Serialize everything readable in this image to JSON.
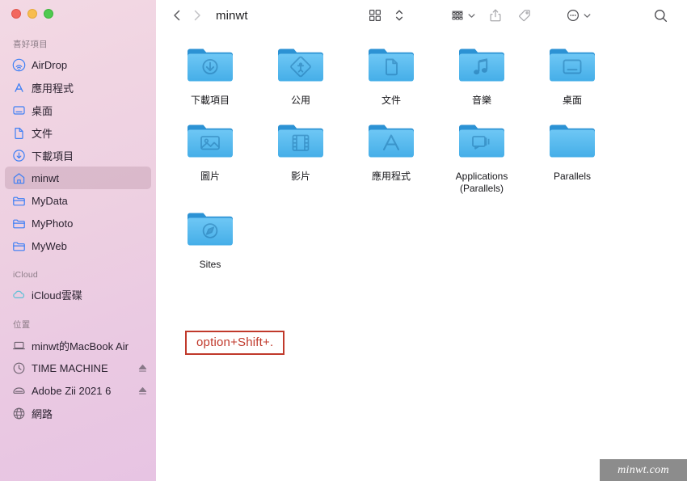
{
  "window": {
    "traffic_lights": [
      {
        "name": "close",
        "color": "#f2685f"
      },
      {
        "name": "minimize",
        "color": "#f8bd4f"
      },
      {
        "name": "maximize",
        "color": "#4fc94f"
      }
    ]
  },
  "toolbar": {
    "back_icon": "chevron-left-icon",
    "forward_icon": "chevron-right-icon",
    "title": "minwt",
    "view_icon": "icon-view-grid-icon",
    "sort_stepper_icon": "up-down-stepper-icon",
    "group_icon": "group-list-icon",
    "group_caret_icon": "chevron-down-icon",
    "share_icon": "share-icon",
    "tag_icon": "tag-icon",
    "more_icon": "more-ellipsis-icon",
    "more_caret_icon": "chevron-down-icon",
    "search_icon": "search-icon"
  },
  "sidebar": {
    "sections": [
      {
        "header": "喜好項目",
        "items": [
          {
            "label": "AirDrop",
            "icon": "airdrop-icon",
            "selected": false,
            "eject": false
          },
          {
            "label": "應用程式",
            "icon": "applications-icon",
            "selected": false,
            "eject": false
          },
          {
            "label": "桌面",
            "icon": "desktop-icon",
            "selected": false,
            "eject": false
          },
          {
            "label": "文件",
            "icon": "document-icon",
            "selected": false,
            "eject": false
          },
          {
            "label": "下載項目",
            "icon": "downloads-icon",
            "selected": false,
            "eject": false
          },
          {
            "label": "minwt",
            "icon": "home-icon",
            "selected": true,
            "eject": false
          },
          {
            "label": "MyData",
            "icon": "folder-icon",
            "selected": false,
            "eject": false
          },
          {
            "label": "MyPhoto",
            "icon": "folder-icon",
            "selected": false,
            "eject": false
          },
          {
            "label": "MyWeb",
            "icon": "folder-icon",
            "selected": false,
            "eject": false
          }
        ]
      },
      {
        "header": "iCloud",
        "items": [
          {
            "label": "iCloud雲碟",
            "icon": "icloud-icon",
            "selected": false,
            "eject": false
          }
        ]
      },
      {
        "header": "位置",
        "items": [
          {
            "label": "minwt的MacBook Air",
            "icon": "laptop-icon",
            "selected": false,
            "eject": false
          },
          {
            "label": "TIME MACHINE",
            "icon": "time-machine-icon",
            "selected": false,
            "eject": true
          },
          {
            "label": "Adobe Zii 2021 6",
            "icon": "disk-image-icon",
            "selected": false,
            "eject": true
          },
          {
            "label": "網路",
            "icon": "network-globe-icon",
            "selected": false,
            "eject": false
          }
        ]
      }
    ]
  },
  "main": {
    "files": [
      {
        "label": "下載項目",
        "icon": "folder-downloads-icon"
      },
      {
        "label": "公用",
        "icon": "folder-public-icon"
      },
      {
        "label": "文件",
        "icon": "folder-documents-icon"
      },
      {
        "label": "音樂",
        "icon": "folder-music-icon"
      },
      {
        "label": "桌面",
        "icon": "folder-desktop-icon"
      },
      {
        "label": "圖片",
        "icon": "folder-pictures-icon"
      },
      {
        "label": "影片",
        "icon": "folder-movies-icon"
      },
      {
        "label": "應用程式",
        "icon": "folder-applications-icon"
      },
      {
        "label": "Applications (Parallels)",
        "icon": "folder-parallels-apps-icon"
      },
      {
        "label": "Parallels",
        "icon": "folder-plain-icon"
      },
      {
        "label": "Sites",
        "icon": "folder-sites-icon"
      }
    ]
  },
  "annotation": {
    "text": "option+Shift+.",
    "color": "#c0392b"
  },
  "watermark": {
    "text": "minwt.com"
  },
  "colors": {
    "sidebar_gradient_start": "#f3d9e4",
    "sidebar_gradient_end": "#e7c4e3",
    "folder_blue": "#58b9f0",
    "folder_blue_dark": "#2f9ada",
    "sidebar_icon_blue": "#3d7ff5",
    "accent_red": "#c0392b"
  }
}
